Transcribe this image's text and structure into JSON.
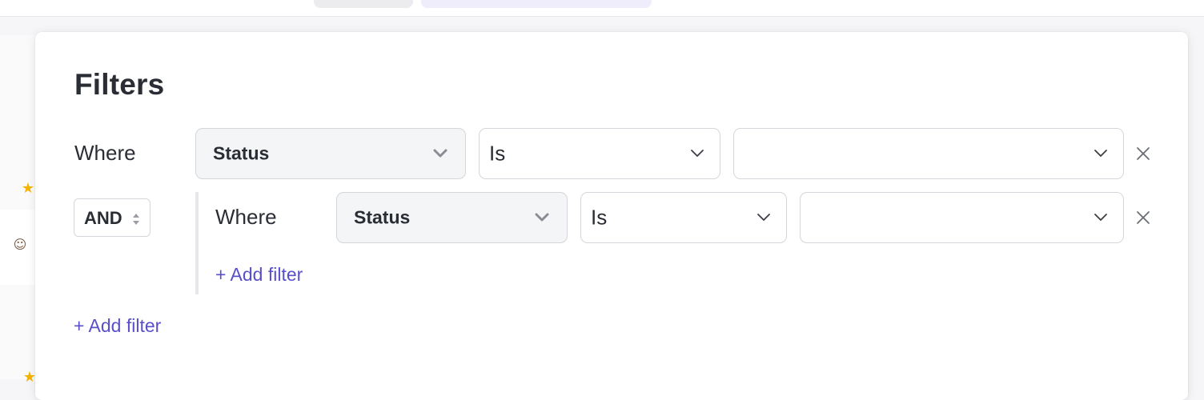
{
  "filters": {
    "title": "Filters",
    "row1": {
      "where_label": "Where",
      "field": "Status",
      "operator": "Is",
      "value": ""
    },
    "group": {
      "conjunction": "AND",
      "row": {
        "where_label": "Where",
        "field": "Status",
        "operator": "Is",
        "value": ""
      },
      "add_filter_label": "+ Add filter"
    },
    "add_filter_label": "+ Add filter"
  },
  "icons": {
    "chevron": "chevron-down-icon",
    "close": "close-icon",
    "sort": "sort-arrows-icon"
  },
  "colors": {
    "accent": "#5b4fc9",
    "text": "#2a2e34",
    "border": "#d5d6db",
    "field_bg": "#f4f5f7"
  }
}
